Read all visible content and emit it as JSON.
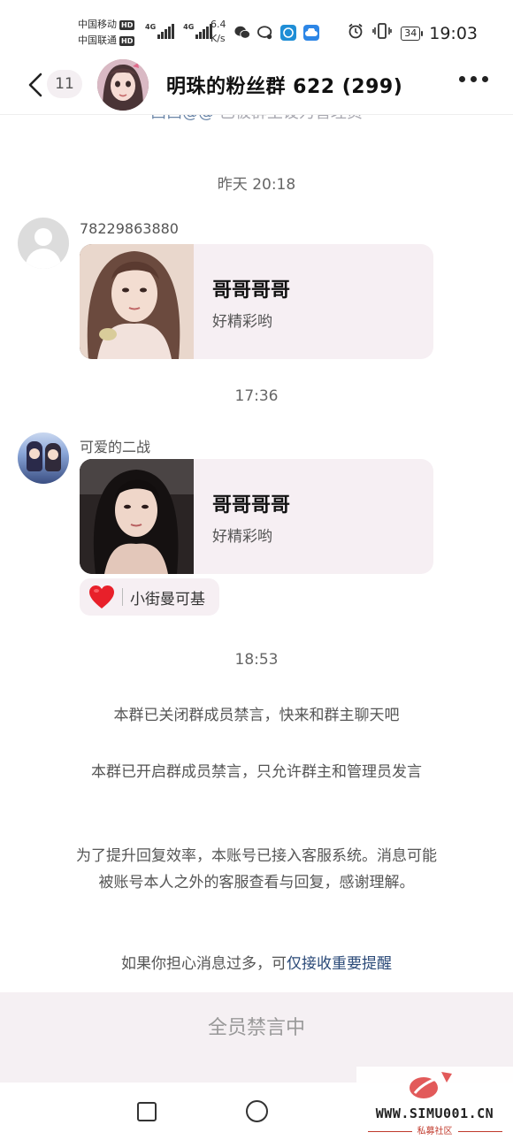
{
  "status_bar": {
    "carrier1": "中国移动",
    "carrier2": "中国联通",
    "hd_label": "HD",
    "net1": "4G",
    "net2": "4G",
    "speed_value": "6.4",
    "speed_unit": "K/s",
    "battery": "34",
    "time": "19:03"
  },
  "header": {
    "unread_count": "11",
    "title": "明珠的粉丝群 622 (299)"
  },
  "partial_line": {
    "mention": "西西@@",
    "text": " 已被群主设为管理员"
  },
  "messages": [
    {
      "time": "昨天 20:18",
      "sender": "78229863880",
      "card_title": "哥哥哥哥",
      "card_desc": "好精彩哟"
    },
    {
      "time": "17:36",
      "sender": "可爱的二战",
      "card_title": "哥哥哥哥",
      "card_desc": "好精彩哟",
      "reaction_user": "小街曼可基"
    }
  ],
  "system": {
    "time": "18:53",
    "msg1": "本群已关闭群成员禁言，快来和群主聊天吧",
    "msg2": "本群已开启群成员禁言，只允许群主和管理员发言",
    "msg3": "为了提升回复效率，本账号已接入客服系统。消息可能被账号本人之外的客服查看与回复，感谢理解。",
    "msg4_prefix": "如果你担心消息过多，可",
    "msg4_link": "仅接收重要提醒"
  },
  "muted_bar": {
    "text": "全员禁言中"
  },
  "watermark": {
    "url": "WWW.SIMU001.CN",
    "sub": "私募社区"
  },
  "colors": {
    "card_bg": "#f6eff3",
    "link": "#2b4a78",
    "heart": "#e8202a"
  }
}
